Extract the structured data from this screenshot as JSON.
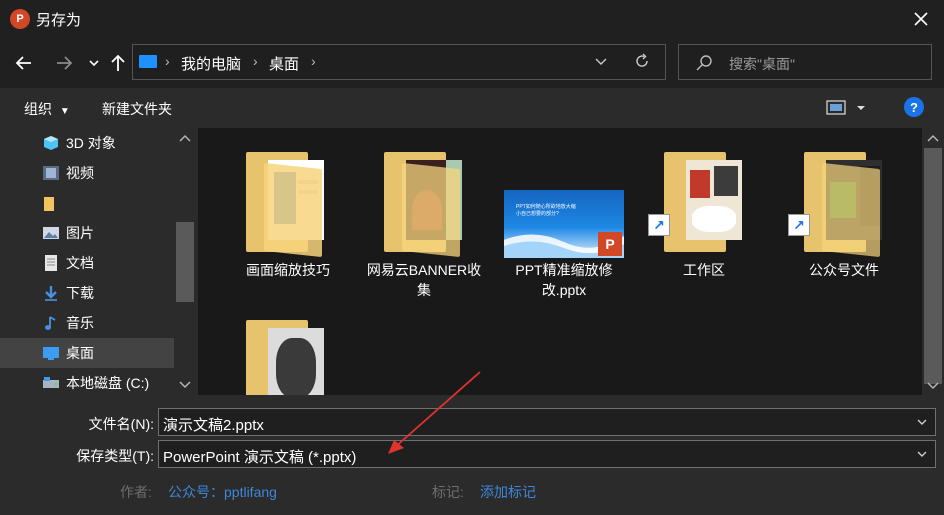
{
  "window": {
    "title": "另存为",
    "app_icon": "powerpoint-icon",
    "app_icon_letter": "P"
  },
  "address_bar": {
    "crumbs": [
      "我的电脑",
      "桌面"
    ],
    "dropdown_icon": "chevron-down-icon",
    "refresh_icon": "refresh-icon"
  },
  "search": {
    "placeholder": "搜索\"桌面\""
  },
  "toolbar": {
    "organize_label": "组织",
    "new_folder_label": "新建文件夹",
    "help_label": "?"
  },
  "sidebar": {
    "items": [
      {
        "label": "3D 对象",
        "icon": "3d-objects-icon"
      },
      {
        "label": "视频",
        "icon": "video-icon"
      },
      {
        "label": "",
        "icon": "folder-icon"
      },
      {
        "label": "图片",
        "icon": "pictures-icon"
      },
      {
        "label": "文档",
        "icon": "documents-icon"
      },
      {
        "label": "下载",
        "icon": "download-icon"
      },
      {
        "label": "音乐",
        "icon": "music-icon"
      },
      {
        "label": "桌面",
        "icon": "desktop-icon",
        "selected": true
      },
      {
        "label": "本地磁盘 (C:)",
        "icon": "drive-icon"
      }
    ]
  },
  "files": [
    {
      "label": "画面缩放技巧",
      "type": "folder"
    },
    {
      "label": "网易云BANNER收集",
      "type": "folder"
    },
    {
      "label": "PPT精准缩放修改.pptx",
      "type": "pptx"
    },
    {
      "label": "工作区",
      "type": "folder-shortcut"
    },
    {
      "label": "公众号文件",
      "type": "folder-shortcut"
    },
    {
      "label": "",
      "type": "folder"
    }
  ],
  "pptx_thumb_text": "PPT如何随心所欲地放大缩小自己想要的部分?",
  "form": {
    "filename_label": "文件名(N):",
    "filename_value": "演示文稿2.pptx",
    "type_label": "保存类型(T):",
    "type_value": "PowerPoint 演示文稿 (*.pptx)",
    "author_label": "作者:",
    "author_value": "公众号：pptlifang",
    "tags_label": "标记:",
    "tags_value": "添加标记"
  },
  "colors": {
    "accent": "#1a73e8",
    "annotation": "#e0332e",
    "link": "#3d87d8"
  }
}
